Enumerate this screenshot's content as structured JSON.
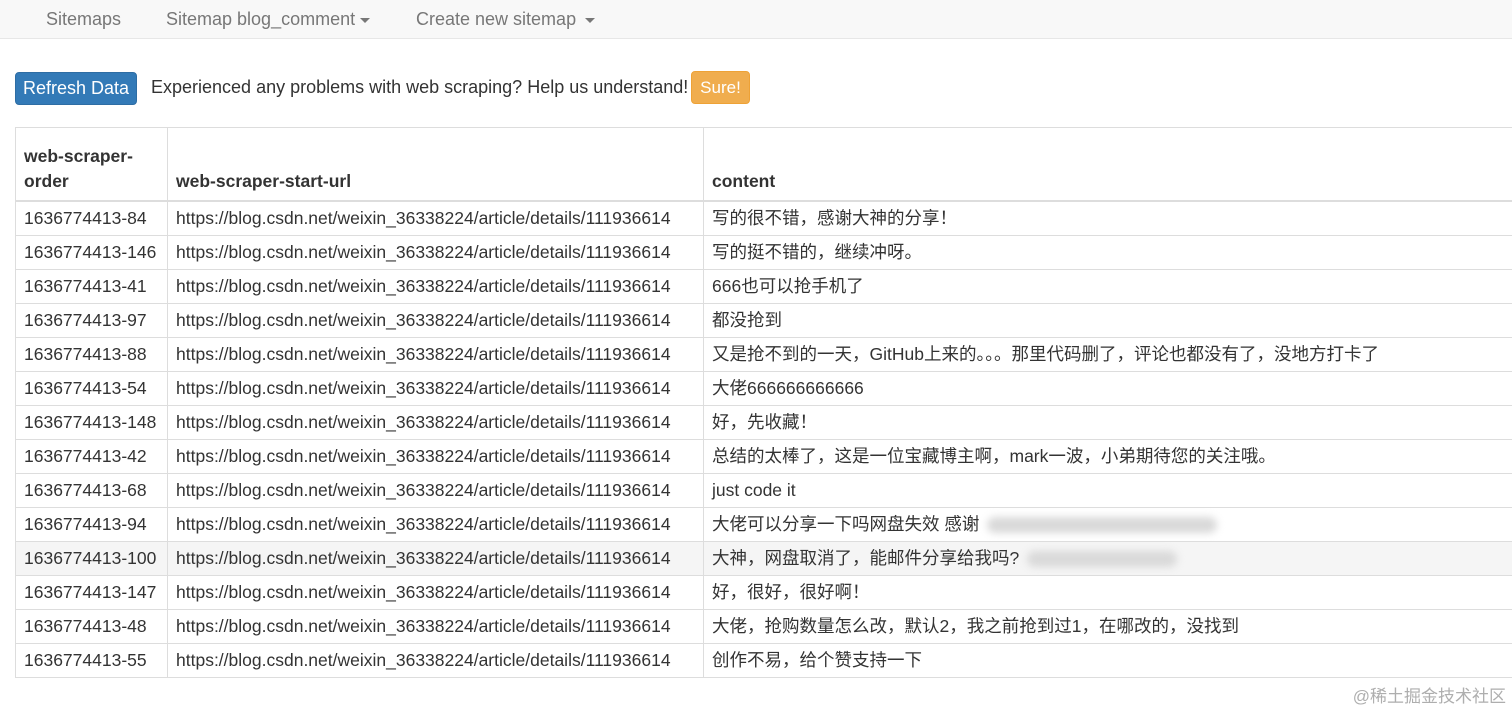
{
  "nav": {
    "sitemaps": "Sitemaps",
    "sitemap_current": "Sitemap blog_comment",
    "create_new": "Create new sitemap"
  },
  "toolbar": {
    "refresh_label": "Refresh Data",
    "prompt": "Experienced any problems with web scraping? Help us understand!",
    "sure_label": "Sure!"
  },
  "table": {
    "headers": [
      "web-scraper-order",
      "web-scraper-start-url",
      "content"
    ],
    "rows": [
      {
        "order": "1636774413-84",
        "url": "https://blog.csdn.net/weixin_36338224/article/details/111936614",
        "content": "写的很不错，感谢大神的分享！"
      },
      {
        "order": "1636774413-146",
        "url": "https://blog.csdn.net/weixin_36338224/article/details/111936614",
        "content": "写的挺不错的，继续冲呀。"
      },
      {
        "order": "1636774413-41",
        "url": "https://blog.csdn.net/weixin_36338224/article/details/111936614",
        "content": "666也可以抢手机了"
      },
      {
        "order": "1636774413-97",
        "url": "https://blog.csdn.net/weixin_36338224/article/details/111936614",
        "content": "都没抢到"
      },
      {
        "order": "1636774413-88",
        "url": "https://blog.csdn.net/weixin_36338224/article/details/111936614",
        "content": "又是抢不到的一天，GitHub上来的。。。那里代码删了，评论也都没有了，没地方打卡了"
      },
      {
        "order": "1636774413-54",
        "url": "https://blog.csdn.net/weixin_36338224/article/details/111936614",
        "content": "大佬666666666666"
      },
      {
        "order": "1636774413-148",
        "url": "https://blog.csdn.net/weixin_36338224/article/details/111936614",
        "content": "好，先收藏！"
      },
      {
        "order": "1636774413-42",
        "url": "https://blog.csdn.net/weixin_36338224/article/details/111936614",
        "content": "总结的太棒了，这是一位宝藏博主啊，mark一波，小弟期待您的关注哦。"
      },
      {
        "order": "1636774413-68",
        "url": "https://blog.csdn.net/weixin_36338224/article/details/111936614",
        "content": "just code it"
      },
      {
        "order": "1636774413-94",
        "url": "https://blog.csdn.net/weixin_36338224/article/details/111936614",
        "content": "大佬可以分享一下吗网盘失效 感谢"
      },
      {
        "order": "1636774413-100",
        "url": "https://blog.csdn.net/weixin_36338224/article/details/111936614",
        "content": "大神，网盘取消了，能邮件分享给我吗?"
      },
      {
        "order": "1636774413-147",
        "url": "https://blog.csdn.net/weixin_36338224/article/details/111936614",
        "content": "好，很好，很好啊！"
      },
      {
        "order": "1636774413-48",
        "url": "https://blog.csdn.net/weixin_36338224/article/details/111936614",
        "content": "大佬，抢购数量怎么改，默认2，我之前抢到过1，在哪改的，没找到"
      },
      {
        "order": "1636774413-55",
        "url": "https://blog.csdn.net/weixin_36338224/article/details/111936614",
        "content": "创作不易，给个赞支持一下"
      }
    ]
  },
  "watermark": "@稀土掘金技术社区",
  "colors": {
    "primary": "#337ab7",
    "warning": "#f0ad4e",
    "navbar_bg": "#f8f8f8"
  }
}
